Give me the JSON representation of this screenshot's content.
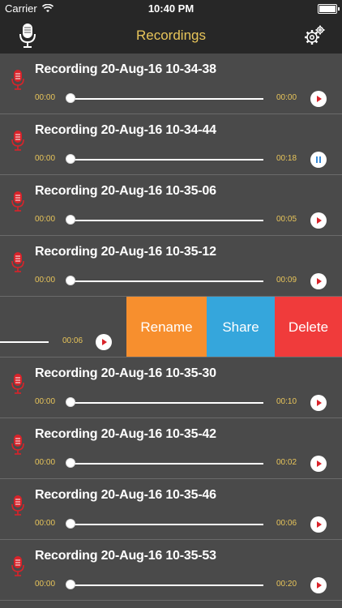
{
  "status": {
    "carrier": "Carrier",
    "time": "10:40 PM"
  },
  "nav": {
    "title": "Recordings"
  },
  "rows": [
    {
      "name": "Recording 20-Aug-16 10-34-38",
      "current": "00:00",
      "duration": "00:00",
      "state": "play"
    },
    {
      "name": "Recording 20-Aug-16 10-34-44",
      "current": "00:00",
      "duration": "00:18",
      "state": "pause"
    },
    {
      "name": "Recording 20-Aug-16 10-35-06",
      "current": "00:00",
      "duration": "00:05",
      "state": "play"
    },
    {
      "name": "Recording 20-Aug-16 10-35-12",
      "current": "00:00",
      "duration": "00:09",
      "state": "play"
    },
    {
      "duration": "00:06",
      "state": "play",
      "actions": [
        "Rename",
        "Share",
        "Delete"
      ]
    },
    {
      "name": "Recording 20-Aug-16 10-35-30",
      "current": "00:00",
      "duration": "00:10",
      "state": "play"
    },
    {
      "name": "Recording 20-Aug-16 10-35-42",
      "current": "00:00",
      "duration": "00:02",
      "state": "play"
    },
    {
      "name": "Recording 20-Aug-16 10-35-46",
      "current": "00:00",
      "duration": "00:06",
      "state": "play"
    },
    {
      "name": "Recording 20-Aug-16 10-35-53",
      "current": "00:00",
      "duration": "00:20",
      "state": "play"
    }
  ],
  "colors": {
    "accent": "#e8c55a",
    "rename": "#f78f2e",
    "share": "#35a6dc",
    "delete": "#f03b3b",
    "mic": "#d9232a"
  }
}
